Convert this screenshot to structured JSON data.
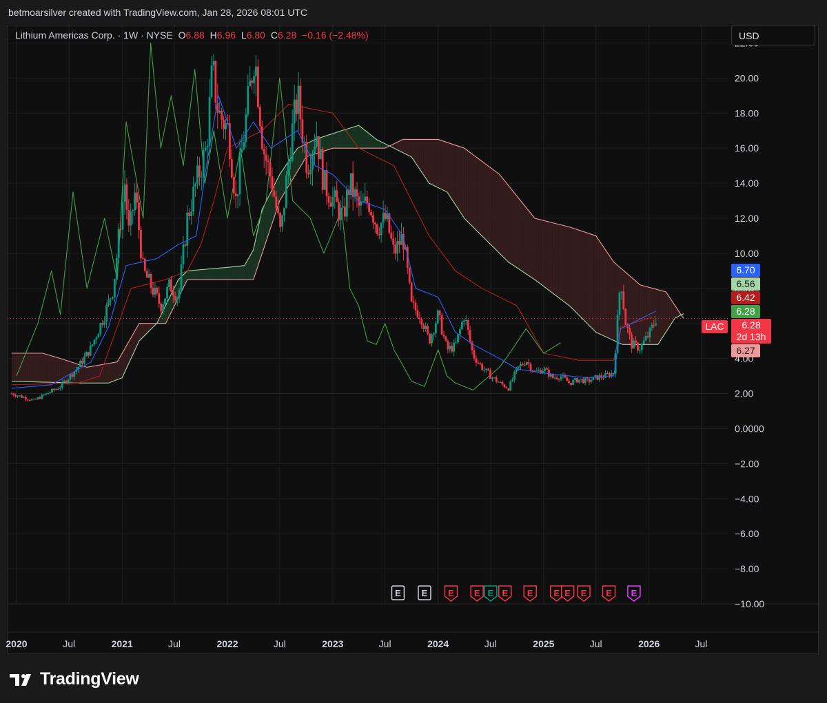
{
  "header": {
    "credit": "betmoarsilver created with TradingView.com, Jan 28, 2026 08:01 UTC"
  },
  "legend": {
    "symbol": "Lithium Americas Corp. · 1W · NYSE",
    "open_label": "O",
    "open": "6.88",
    "high_label": "H",
    "high": "6.96",
    "low_label": "L",
    "low": "6.80",
    "close_label": "C",
    "close": "6.28",
    "change": "−0.16 (−2.48%)"
  },
  "currency": "USD",
  "brand": "TradingView",
  "colors": {
    "background": "#0f0f0f",
    "up_candle": "#089981",
    "down_candle": "#f23645",
    "tenkan": "#2962ff",
    "kijun": "#b71c1c",
    "chikou": "#43a047",
    "span_a": "#a5d6a7",
    "span_b": "#ef9a9a",
    "cloud_bull": "#1b3a24",
    "cloud_bear": "#3a1e1e",
    "earnings_red": "#f23645",
    "earnings_green": "#089981",
    "earnings_purple": "#e040fb"
  },
  "price_labels": [
    {
      "name": "tenkan-sen-price",
      "value": "6.70",
      "color": "#2962ff"
    },
    {
      "name": "span-a-price",
      "value": "6.56",
      "color": "#a5d6a7",
      "text": "#1a1a1a"
    },
    {
      "name": "kijun-sen-price",
      "value": "6.42",
      "color": "#b71c1c"
    },
    {
      "name": "chikou-price",
      "value": "6.28",
      "color": "#43a047"
    },
    {
      "name": "last-price",
      "value": "6.28",
      "color": "#f23645"
    },
    {
      "name": "span-b-price",
      "value": "6.27",
      "color": "#ef9a9a",
      "text": "#1a1a1a"
    }
  ],
  "last_price_symbol": "LAC",
  "countdown": "2d 13h",
  "chart_data": {
    "type": "candlestick",
    "interval": "1W",
    "ylim": [
      -10,
      23
    ],
    "yticks": [
      "22.00",
      "20.00",
      "18.00",
      "16.00",
      "14.00",
      "12.00",
      "10.00",
      "8.00",
      "6.00",
      "4.00",
      "2.00",
      "0.0000",
      "−2.00",
      "−4.00",
      "−6.00",
      "−8.00",
      "−10.00"
    ],
    "ytick_values": [
      22,
      20,
      18,
      16,
      14,
      12,
      10,
      8,
      6,
      4,
      2,
      0,
      -2,
      -4,
      -6,
      -8,
      -10
    ],
    "xticks": [
      "2020",
      "Jul",
      "2021",
      "Jul",
      "2022",
      "Jul",
      "2023",
      "Jul",
      "2024",
      "Jul",
      "2025",
      "Jul",
      "2026",
      "Jul"
    ],
    "xtick_dates": [
      "2020-01-01",
      "2020-07-01",
      "2021-01-01",
      "2021-07-01",
      "2022-01-01",
      "2022-07-01",
      "2023-01-01",
      "2023-07-01",
      "2024-01-01",
      "2024-07-01",
      "2025-01-01",
      "2025-07-01",
      "2026-01-01",
      "2026-07-01"
    ],
    "xlim": [
      "2019-12-01",
      "2026-10-01"
    ],
    "last_price": 6.28,
    "price_points": [
      [
        "2019-12-15",
        2.0
      ],
      [
        "2020-03-01",
        1.6
      ],
      [
        "2020-04-15",
        2.0
      ],
      [
        "2020-06-01",
        2.4
      ],
      [
        "2020-08-01",
        3.5
      ],
      [
        "2020-09-15",
        4.6
      ],
      [
        "2020-11-01",
        6.5
      ],
      [
        "2020-12-01",
        8.0
      ],
      [
        "2021-01-10",
        14.0
      ],
      [
        "2021-01-25",
        11.0
      ],
      [
        "2021-02-15",
        13.5
      ],
      [
        "2021-03-15",
        9.0
      ],
      [
        "2021-04-15",
        8.0
      ],
      [
        "2021-05-15",
        7.0
      ],
      [
        "2021-06-15",
        8.2
      ],
      [
        "2021-07-15",
        7.5
      ],
      [
        "2021-08-15",
        12.0
      ],
      [
        "2021-09-15",
        14.0
      ],
      [
        "2021-10-20",
        16.0
      ],
      [
        "2021-11-10",
        20.5
      ],
      [
        "2021-12-01",
        18.0
      ],
      [
        "2022-01-05",
        17.0
      ],
      [
        "2022-01-30",
        13.0
      ],
      [
        "2022-03-01",
        17.0
      ],
      [
        "2022-04-05",
        21.5
      ],
      [
        "2022-05-05",
        16.0
      ],
      [
        "2022-06-05",
        14.0
      ],
      [
        "2022-07-05",
        11.0
      ],
      [
        "2022-08-05",
        16.0
      ],
      [
        "2022-09-01",
        19.0
      ],
      [
        "2022-10-05",
        15.0
      ],
      [
        "2022-11-05",
        17.0
      ],
      [
        "2022-12-01",
        14.0
      ],
      [
        "2023-01-05",
        13.0
      ],
      [
        "2023-02-05",
        12.0
      ],
      [
        "2023-03-01",
        14.0
      ],
      [
        "2023-04-05",
        12.5
      ],
      [
        "2023-05-05",
        13.0
      ],
      [
        "2023-06-05",
        11.5
      ],
      [
        "2023-07-05",
        12.0
      ],
      [
        "2023-08-01",
        10.0
      ],
      [
        "2023-09-01",
        11.0
      ],
      [
        "2023-10-01",
        7.0
      ],
      [
        "2023-11-01",
        6.5
      ],
      [
        "2023-12-01",
        5.0
      ],
      [
        "2024-01-01",
        6.5
      ],
      [
        "2024-02-01",
        4.5
      ],
      [
        "2024-03-01",
        4.7
      ],
      [
        "2024-04-01",
        6.5
      ],
      [
        "2024-05-01",
        4.2
      ],
      [
        "2024-06-01",
        3.5
      ],
      [
        "2024-07-01",
        3.0
      ],
      [
        "2024-08-01",
        2.6
      ],
      [
        "2024-09-01",
        2.3
      ],
      [
        "2024-10-01",
        3.4
      ],
      [
        "2024-11-01",
        3.9
      ],
      [
        "2024-12-01",
        3.2
      ],
      [
        "2025-01-01",
        3.4
      ],
      [
        "2025-02-01",
        2.9
      ],
      [
        "2025-03-01",
        3.0
      ],
      [
        "2025-04-01",
        2.6
      ],
      [
        "2025-05-01",
        2.8
      ],
      [
        "2025-06-01",
        2.7
      ],
      [
        "2025-07-01",
        2.9
      ],
      [
        "2025-08-01",
        3.0
      ],
      [
        "2025-09-01",
        3.2
      ],
      [
        "2025-09-25",
        8.7
      ],
      [
        "2025-10-10",
        6.2
      ],
      [
        "2025-11-01",
        4.8
      ],
      [
        "2025-12-01",
        4.6
      ],
      [
        "2026-01-05",
        5.5
      ],
      [
        "2026-01-25",
        6.28
      ]
    ],
    "tenkan_points": [
      [
        "2019-12-15",
        2.3
      ],
      [
        "2020-05-01",
        2.5
      ],
      [
        "2020-09-15",
        3.8
      ],
      [
        "2020-11-15",
        5.8
      ],
      [
        "2021-01-15",
        9.3
      ],
      [
        "2021-05-01",
        9.7
      ],
      [
        "2021-07-15",
        10.5
      ],
      [
        "2021-09-15",
        11.0
      ],
      [
        "2021-10-20",
        15.0
      ],
      [
        "2021-12-01",
        19.0
      ],
      [
        "2022-02-01",
        16.0
      ],
      [
        "2022-04-01",
        17.5
      ],
      [
        "2022-06-01",
        16.0
      ],
      [
        "2022-09-01",
        17.0
      ],
      [
        "2022-11-01",
        15.0
      ],
      [
        "2023-01-01",
        14.5
      ],
      [
        "2023-04-01",
        13.0
      ],
      [
        "2023-07-01",
        12.5
      ],
      [
        "2023-09-01",
        11.0
      ],
      [
        "2023-10-15",
        8.0
      ],
      [
        "2024-01-01",
        7.5
      ],
      [
        "2024-03-01",
        5.5
      ],
      [
        "2024-05-01",
        4.8
      ],
      [
        "2024-08-01",
        4.0
      ],
      [
        "2024-10-01",
        3.4
      ],
      [
        "2025-02-01",
        3.1
      ],
      [
        "2025-06-01",
        2.9
      ],
      [
        "2025-09-01",
        3.0
      ],
      [
        "2025-09-25",
        5.7
      ],
      [
        "2026-01-25",
        6.7
      ]
    ],
    "kijun_points": [
      [
        "2019-12-15",
        2.5
      ],
      [
        "2020-08-01",
        2.6
      ],
      [
        "2020-10-15",
        3.0
      ],
      [
        "2021-02-01",
        8.0
      ],
      [
        "2021-06-01",
        8.5
      ],
      [
        "2021-08-15",
        9.0
      ],
      [
        "2021-10-01",
        10.5
      ],
      [
        "2021-11-15",
        13.0
      ],
      [
        "2022-01-01",
        16.0
      ],
      [
        "2022-05-01",
        17.0
      ],
      [
        "2022-08-01",
        18.5
      ],
      [
        "2023-01-01",
        18.0
      ],
      [
        "2023-04-01",
        16.0
      ],
      [
        "2023-08-01",
        15.0
      ],
      [
        "2023-10-01",
        13.0
      ],
      [
        "2023-12-01",
        11.0
      ],
      [
        "2024-03-01",
        9.0
      ],
      [
        "2024-06-01",
        8.0
      ],
      [
        "2024-10-01",
        7.0
      ],
      [
        "2025-01-01",
        4.3
      ],
      [
        "2025-05-01",
        3.9
      ],
      [
        "2025-09-01",
        3.9
      ],
      [
        "2025-09-25",
        5.8
      ],
      [
        "2026-01-25",
        6.42
      ]
    ],
    "chikou_points": [
      [
        "2020-01-01",
        3.0
      ],
      [
        "2020-03-15",
        6.0
      ],
      [
        "2020-05-01",
        9.0
      ],
      [
        "2020-06-01",
        6.5
      ],
      [
        "2020-07-15",
        13.5
      ],
      [
        "2020-09-01",
        8.0
      ],
      [
        "2020-11-01",
        12.0
      ],
      [
        "2020-12-15",
        8.5
      ],
      [
        "2021-01-15",
        17.5
      ],
      [
        "2021-03-15",
        12.0
      ],
      [
        "2021-04-10",
        22.0
      ],
      [
        "2021-05-15",
        16.0
      ],
      [
        "2021-06-20",
        19.0
      ],
      [
        "2021-08-01",
        15.0
      ],
      [
        "2021-09-10",
        20.5
      ],
      [
        "2021-10-15",
        14.0
      ],
      [
        "2021-11-15",
        17.0
      ],
      [
        "2022-01-01",
        12.0
      ],
      [
        "2022-02-15",
        16.0
      ],
      [
        "2022-04-01",
        11.0
      ],
      [
        "2022-05-15",
        13.0
      ],
      [
        "2022-07-01",
        20.0
      ],
      [
        "2022-08-15",
        13.0
      ],
      [
        "2022-10-15",
        12.0
      ],
      [
        "2022-12-01",
        10.0
      ],
      [
        "2023-02-01",
        12.5
      ],
      [
        "2023-03-01",
        8.0
      ],
      [
        "2023-04-01",
        7.0
      ],
      [
        "2023-05-01",
        5.0
      ],
      [
        "2023-06-01",
        4.8
      ],
      [
        "2023-07-01",
        6.0
      ],
      [
        "2023-08-01",
        4.5
      ],
      [
        "2023-09-01",
        3.6
      ],
      [
        "2023-10-01",
        2.7
      ],
      [
        "2023-11-15",
        2.4
      ],
      [
        "2024-01-01",
        4.5
      ],
      [
        "2024-02-01",
        3.0
      ],
      [
        "2024-03-01",
        2.6
      ],
      [
        "2024-05-01",
        2.2
      ],
      [
        "2024-08-01",
        3.5
      ],
      [
        "2024-09-01",
        4.2
      ],
      [
        "2024-11-01",
        5.7
      ],
      [
        "2025-01-01",
        4.3
      ],
      [
        "2025-03-01",
        4.9
      ]
    ],
    "span_a_points": [
      [
        "2019-12-15",
        2.7
      ],
      [
        "2020-08-01",
        2.6
      ],
      [
        "2020-11-15",
        2.6
      ],
      [
        "2021-01-01",
        2.9
      ],
      [
        "2021-03-01",
        5.0
      ],
      [
        "2021-05-01",
        6.0
      ],
      [
        "2021-07-15",
        8.5
      ],
      [
        "2021-08-15",
        9.0
      ],
      [
        "2022-01-01",
        9.2
      ],
      [
        "2022-03-01",
        9.3
      ],
      [
        "2022-04-01",
        10.2
      ],
      [
        "2022-05-01",
        12.5
      ],
      [
        "2022-07-01",
        14.5
      ],
      [
        "2022-09-01",
        16.0
      ],
      [
        "2022-11-01",
        16.5
      ],
      [
        "2023-02-01",
        17.0
      ],
      [
        "2023-04-01",
        17.3
      ],
      [
        "2023-06-01",
        16.5
      ],
      [
        "2023-08-01",
        16.0
      ],
      [
        "2023-10-01",
        15.5
      ],
      [
        "2023-12-01",
        14.0
      ],
      [
        "2024-02-01",
        13.5
      ],
      [
        "2024-04-01",
        12.0
      ],
      [
        "2024-06-01",
        11.0
      ],
      [
        "2024-09-01",
        9.5
      ],
      [
        "2024-12-01",
        8.5
      ],
      [
        "2025-04-01",
        7.0
      ],
      [
        "2025-07-01",
        5.5
      ],
      [
        "2025-10-01",
        4.8
      ],
      [
        "2026-02-01",
        4.8
      ],
      [
        "2026-04-01",
        6.3
      ],
      [
        "2026-05-01",
        6.56
      ]
    ],
    "span_b_points": [
      [
        "2019-12-15",
        4.3
      ],
      [
        "2020-04-01",
        4.3
      ],
      [
        "2020-06-01",
        4.0
      ],
      [
        "2020-09-01",
        3.5
      ],
      [
        "2020-12-15",
        3.8
      ],
      [
        "2021-03-01",
        6.0
      ],
      [
        "2021-06-01",
        6.0
      ],
      [
        "2021-08-15",
        8.5
      ],
      [
        "2022-01-01",
        8.5
      ],
      [
        "2022-04-01",
        8.5
      ],
      [
        "2022-07-01",
        13.0
      ],
      [
        "2022-10-01",
        15.5
      ],
      [
        "2023-01-01",
        16.0
      ],
      [
        "2023-07-01",
        16.0
      ],
      [
        "2023-09-01",
        16.5
      ],
      [
        "2024-01-01",
        16.5
      ],
      [
        "2024-04-01",
        16.0
      ],
      [
        "2024-08-01",
        14.5
      ],
      [
        "2024-12-01",
        12.0
      ],
      [
        "2025-04-01",
        11.5
      ],
      [
        "2025-07-01",
        11.0
      ],
      [
        "2025-09-01",
        9.5
      ],
      [
        "2025-12-01",
        8.2
      ],
      [
        "2026-03-01",
        7.8
      ],
      [
        "2026-05-01",
        6.27
      ]
    ],
    "earnings_markers": [
      {
        "date": "2023-08-15",
        "label": "E",
        "kind": "neutral"
      },
      {
        "date": "2023-11-15",
        "label": "E",
        "kind": "neutral"
      },
      {
        "date": "2024-02-15",
        "label": "E",
        "kind": "red"
      },
      {
        "date": "2024-05-15",
        "label": "E",
        "kind": "red"
      },
      {
        "date": "2024-07-01",
        "label": "E",
        "kind": "green"
      },
      {
        "date": "2024-08-20",
        "label": "E",
        "kind": "red"
      },
      {
        "date": "2024-11-15",
        "label": "E",
        "kind": "red"
      },
      {
        "date": "2025-02-15",
        "label": "E",
        "kind": "red"
      },
      {
        "date": "2025-03-25",
        "label": "E",
        "kind": "red"
      },
      {
        "date": "2025-05-20",
        "label": "E",
        "kind": "red"
      },
      {
        "date": "2025-08-15",
        "label": "E",
        "kind": "red"
      },
      {
        "date": "2025-11-10",
        "label": "E",
        "kind": "purple"
      }
    ]
  }
}
